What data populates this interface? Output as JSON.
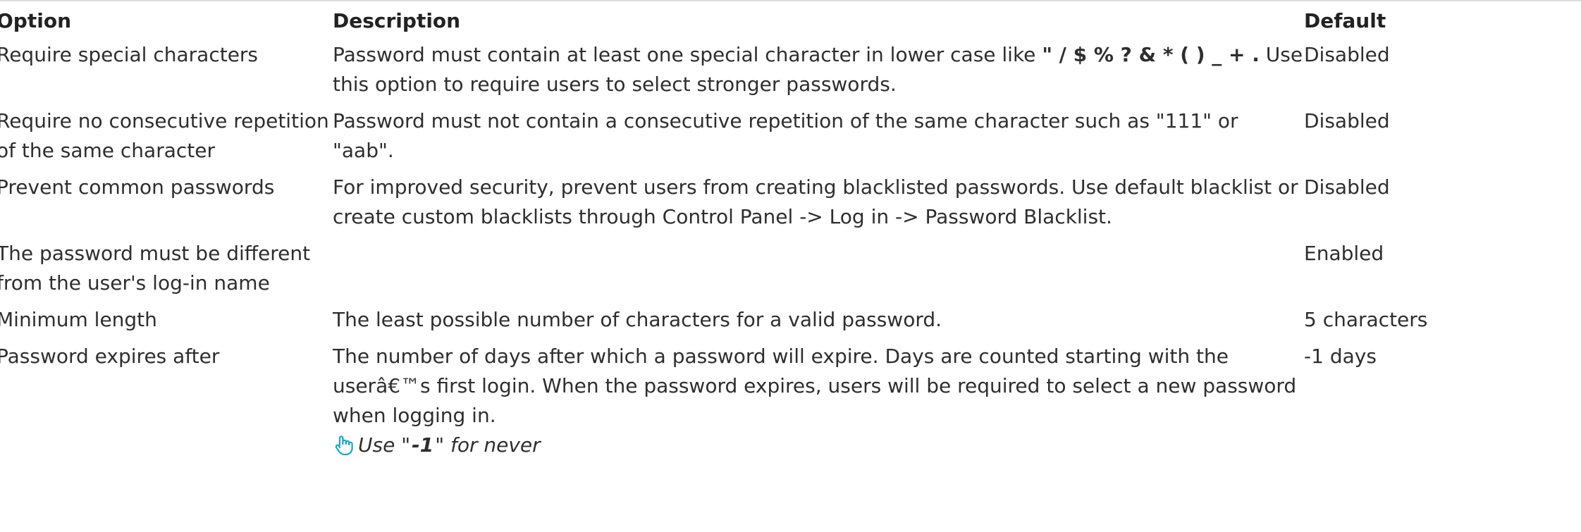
{
  "table": {
    "headers": {
      "option": "Option",
      "description": "Description",
      "default": "Default"
    },
    "rows": [
      {
        "option": "Require special characters",
        "description_before": "Password must contain at least one special character in lower case like ",
        "description_emph": "\" / $ % ? & * ( ) _ + .",
        "description_after": " Use this option to require users to select stronger passwords.",
        "default": "Disabled"
      },
      {
        "option": "Require no consecutive repetition of the same character",
        "description": "Password must not contain a consecutive repetition of the same character such as \"111\" or \"aab\".",
        "default": "Disabled"
      },
      {
        "option": "Prevent common passwords",
        "description": "For improved security, prevent users from creating blacklisted passwords. Use default blacklist or create custom blacklists through Control Panel -> Log in -> Password Blacklist.",
        "default": "Disabled"
      },
      {
        "option": "The password must be different from the user's log-in name",
        "description": "",
        "default": "Enabled"
      },
      {
        "option": "Minimum length",
        "description": "The least possible number of characters for a valid password.",
        "default": "5 characters"
      },
      {
        "option": "Password expires after",
        "description": "The number of days after which a password will expire. Days are counted starting with the userâ€™s first login. When the password expires, users will be required to select a new password when logging in.",
        "note_prefix": "Use \"",
        "note_value": "-1",
        "note_suffix": "\" for never",
        "default": "-1 days"
      }
    ]
  },
  "icons": {
    "note_icon": "pointing-hand-icon",
    "note_icon_color": "#19a8c9"
  }
}
